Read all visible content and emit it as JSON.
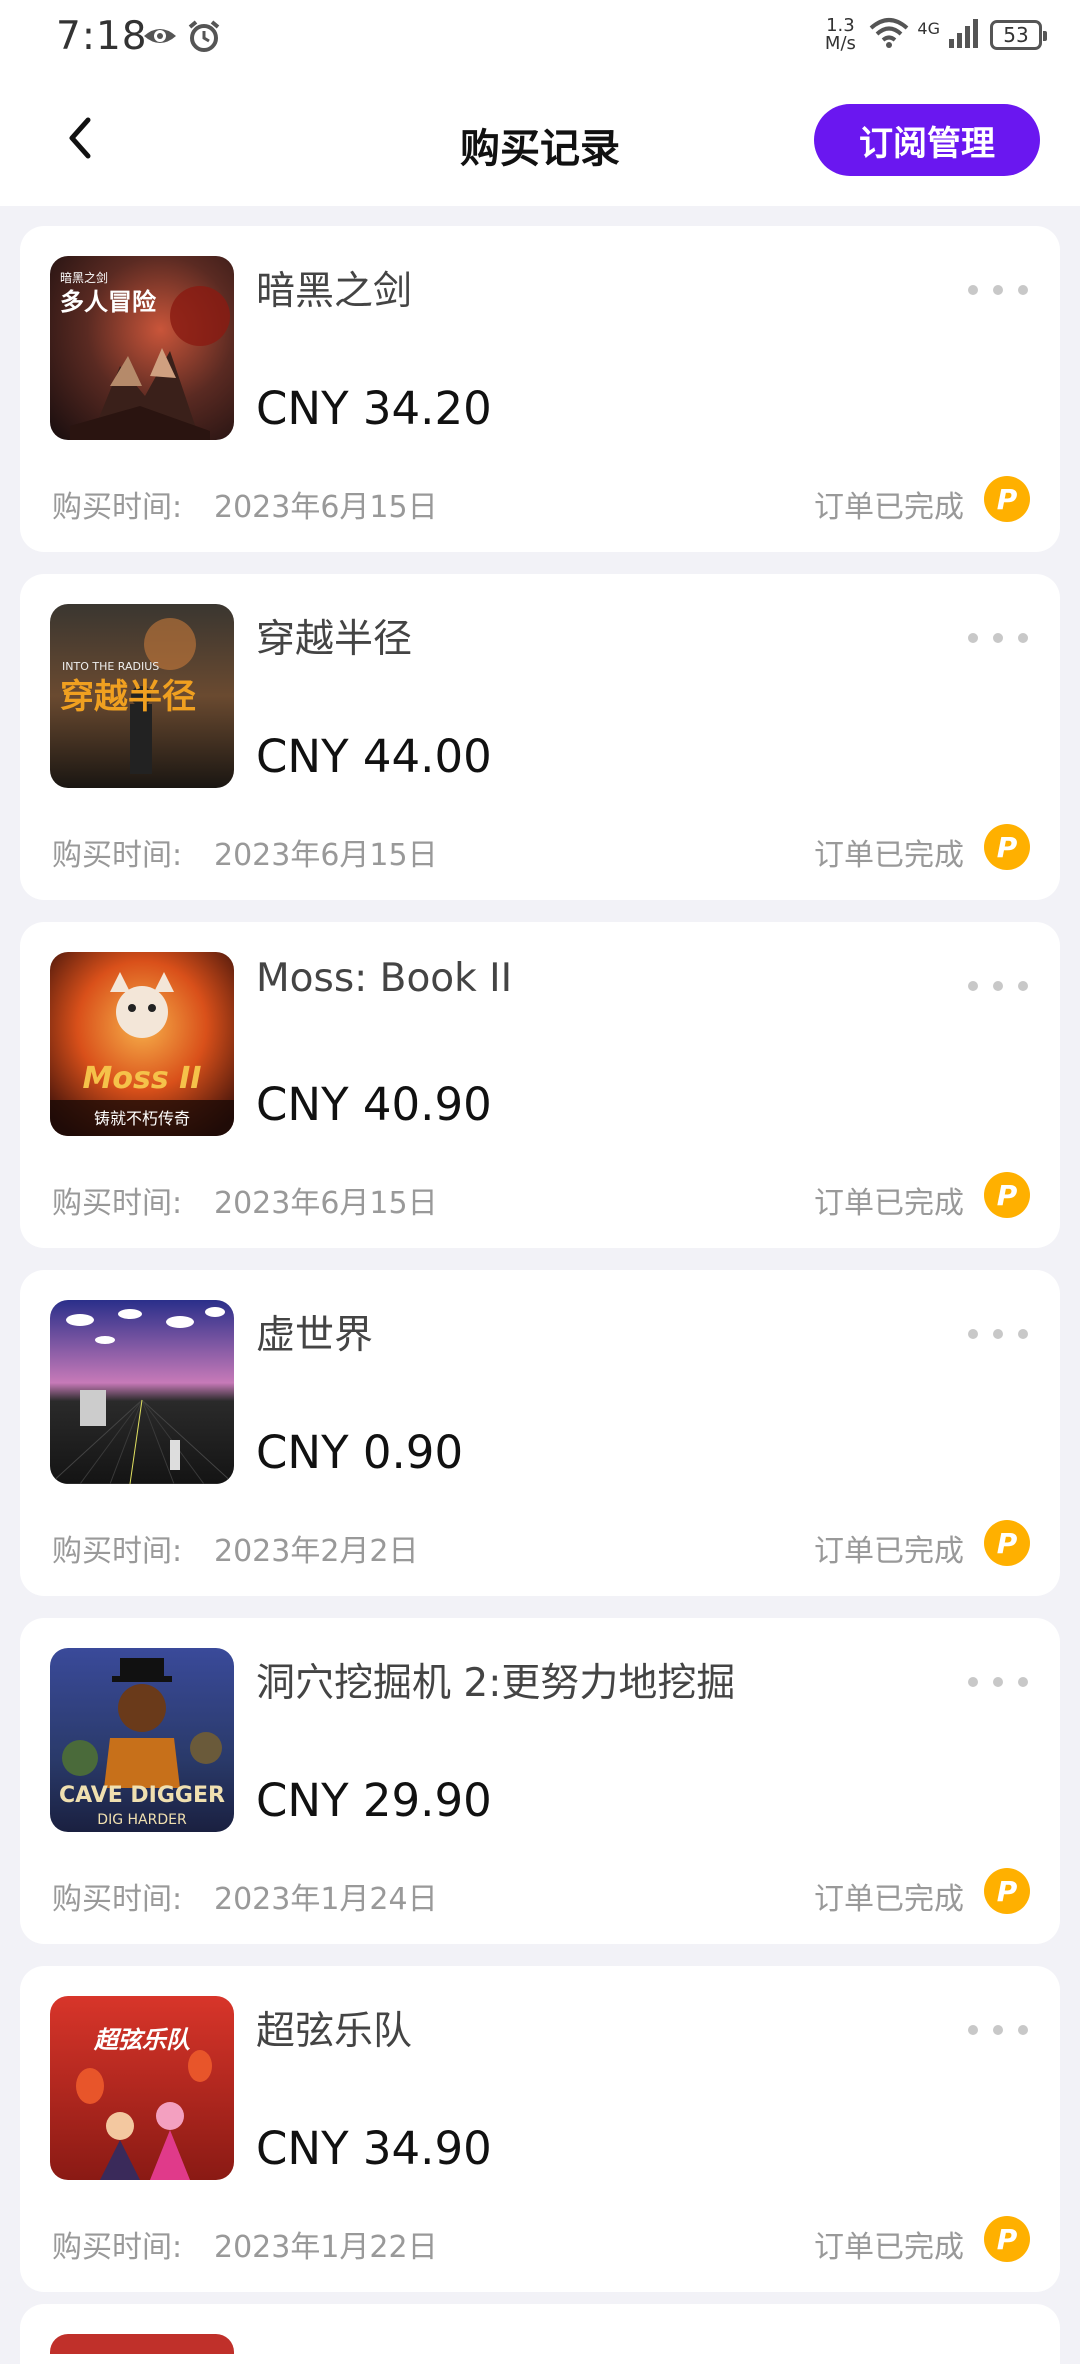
{
  "status_bar": {
    "time": "7:18",
    "net_speed_value": "1.3",
    "net_speed_unit": "M/s",
    "network_type": "4G",
    "battery": "53",
    "icons": [
      "eye-icon",
      "alarm-icon",
      "wifi-icon",
      "signal-icon",
      "battery-icon"
    ]
  },
  "nav": {
    "title": "购买记录",
    "subscribe_label": "订阅管理",
    "accent_color": "#6a17f0"
  },
  "orders": [
    {
      "title": "暗黑之剑",
      "price": "CNY 34.20",
      "purchase_label": "购买时间:",
      "purchase_date": "2023年6月15日",
      "status": "订单已完成",
      "badge": "P",
      "cover_text": "多人冒险",
      "cover_small_text": "暗黑之剑"
    },
    {
      "title": "穿越半径",
      "price": "CNY 44.00",
      "purchase_label": "购买时间:",
      "purchase_date": "2023年6月15日",
      "status": "订单已完成",
      "badge": "P",
      "cover_text": "穿越半径",
      "cover_small_text": "INTO THE RADIUS"
    },
    {
      "title": "Moss: Book II",
      "price": "CNY 40.90",
      "purchase_label": "购买时间:",
      "purchase_date": "2023年6月15日",
      "status": "订单已完成",
      "badge": "P",
      "cover_text": "Moss II",
      "cover_small_text": "铸就不朽传奇"
    },
    {
      "title": "虚世界",
      "price": "CNY 0.90",
      "purchase_label": "购买时间:",
      "purchase_date": "2023年2月2日",
      "status": "订单已完成",
      "badge": "P",
      "cover_text": "",
      "cover_small_text": ""
    },
    {
      "title": "洞穴挖掘机 2:更努力地挖掘",
      "price": "CNY 29.90",
      "purchase_label": "购买时间:",
      "purchase_date": "2023年1月24日",
      "status": "订单已完成",
      "badge": "P",
      "cover_text": "CAVE DIGGER",
      "cover_small_text": "DIG HARDER"
    },
    {
      "title": "超弦乐队",
      "price": "CNY 34.90",
      "purchase_label": "购买时间:",
      "purchase_date": "2023年1月22日",
      "status": "订单已完成",
      "badge": "P",
      "cover_text": "超弦乐队",
      "cover_small_text": ""
    }
  ]
}
